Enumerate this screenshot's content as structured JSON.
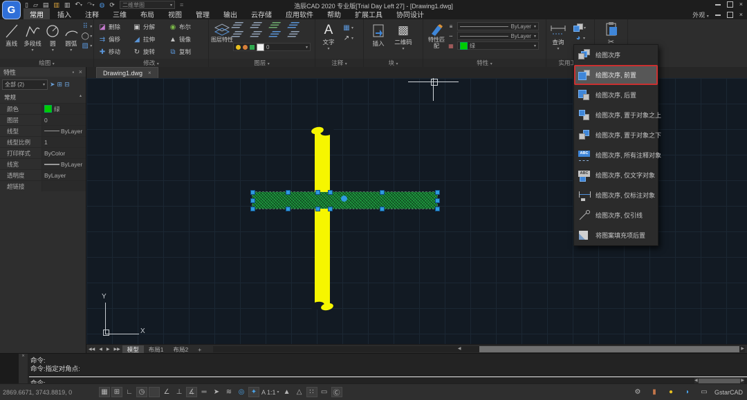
{
  "window": {
    "logo": "G",
    "title": "浩辰CAD 2020 专业版[Trial Day Left 27] - [Drawing1.dwg]",
    "workspace": "二维草图",
    "appearance": "外观"
  },
  "menu": {
    "items": [
      "常用",
      "插入",
      "注释",
      "三维",
      "布局",
      "视图",
      "管理",
      "输出",
      "云存储",
      "应用软件",
      "帮助",
      "扩展工具",
      "协同设计"
    ]
  },
  "ribbon": {
    "draw": {
      "label": "绘图",
      "line": "直线",
      "polyline": "多段线",
      "circle": "圆",
      "arc": "圆弧"
    },
    "modify": {
      "label": "修改",
      "erase": "删除",
      "explode": "分解",
      "boolean": "布尔",
      "offset": "偏移",
      "stretch": "拉伸",
      "mirror": "镜像",
      "move": "移动",
      "rotate": "旋转",
      "copy": "复制"
    },
    "layer": {
      "label": "图层",
      "properties": "图层特性",
      "current": "0"
    },
    "annotate": {
      "label": "注释",
      "glyph": "A",
      "text": "文字"
    },
    "block": {
      "label": "块",
      "insert": "插入",
      "qrcode": "二维码"
    },
    "properties": {
      "label": "特性",
      "match": "特性匹配",
      "linetype": "ByLayer",
      "lineweight": "ByLayer",
      "color_name": "绿"
    },
    "utilities": {
      "label": "实用工具",
      "inquiry": "查询"
    },
    "clipboard": {
      "label": ""
    }
  },
  "document_tab": {
    "name": "Drawing1.dwg"
  },
  "properties_panel": {
    "title": "特性",
    "selector": "全部 (2)",
    "section": "常规",
    "rows": [
      {
        "label": "颜色",
        "value": "绿"
      },
      {
        "label": "图层",
        "value": "0"
      },
      {
        "label": "线型",
        "value": "ByLayer"
      },
      {
        "label": "线型比例",
        "value": "1"
      },
      {
        "label": "打印样式",
        "value": "ByColor"
      },
      {
        "label": "线宽",
        "value": "ByLayer"
      },
      {
        "label": "透明度",
        "value": "ByLayer"
      },
      {
        "label": "超链接",
        "value": ""
      }
    ]
  },
  "draw_order_menu": {
    "items": [
      {
        "label": "绘图次序"
      },
      {
        "label": "绘图次序, 前置",
        "highlighted": true
      },
      {
        "label": "绘图次序, 后置"
      },
      {
        "label": "绘图次序, 置于对象之上"
      },
      {
        "label": "绘图次序, 置于对象之下"
      },
      {
        "label": "绘图次序, 所有注释对象"
      },
      {
        "label": "绘图次序, 仅文字对象"
      },
      {
        "label": "绘图次序, 仅标注对象"
      },
      {
        "label": "绘图次序, 仅引线"
      },
      {
        "label": "将图案填充项后置"
      }
    ]
  },
  "layout_tabs": {
    "model": "模型",
    "layout1": "布局1",
    "layout2": "布局2",
    "add": "+"
  },
  "ucs": {
    "x": "X",
    "y": "Y"
  },
  "command": {
    "line1": "命令:",
    "line2": "命令:指定对角点:",
    "line3": "命令:"
  },
  "status": {
    "coordinates": "2869.6671, 3743.8819, 0",
    "scale_glyph": "A",
    "scale": "1:1",
    "brand": "GstarCAD"
  },
  "icons": {
    "abc": "ABC"
  },
  "colors": {
    "selection": "#2f9be0",
    "hatch_green": "#1f9b41",
    "yellow": "#f6f600",
    "highlight_red": "#cc3030",
    "swatch_green": "#00cc00"
  }
}
